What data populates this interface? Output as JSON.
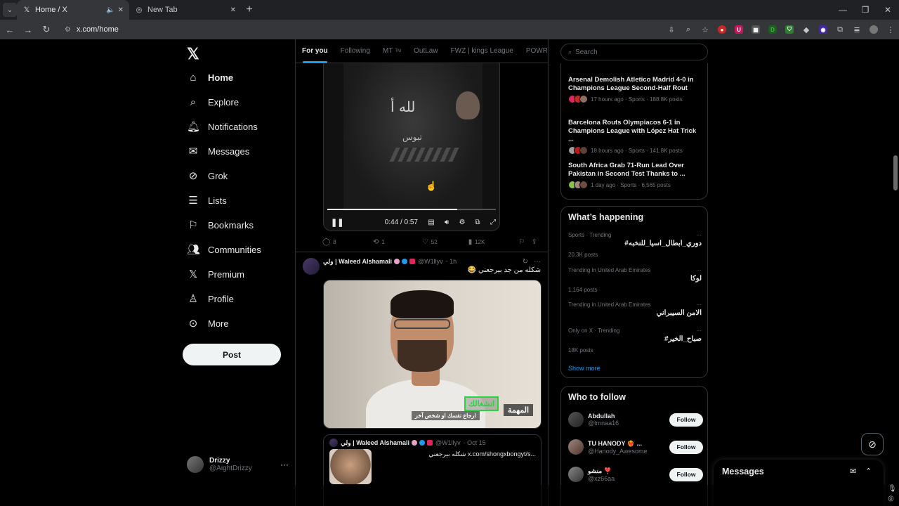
{
  "browser": {
    "tabs": [
      {
        "title": "Home / X",
        "favicon": "x-logo-icon",
        "active": true
      },
      {
        "title": "New Tab",
        "favicon": "chrome-icon",
        "active": false
      }
    ],
    "url": "x.com/home"
  },
  "nav": {
    "items": [
      {
        "label": "Home",
        "icon": "home-icon"
      },
      {
        "label": "Explore",
        "icon": "search-icon"
      },
      {
        "label": "Notifications",
        "icon": "bell-icon"
      },
      {
        "label": "Messages",
        "icon": "mail-icon"
      },
      {
        "label": "Grok",
        "icon": "grok-icon"
      },
      {
        "label": "Lists",
        "icon": "list-icon"
      },
      {
        "label": "Bookmarks",
        "icon": "bookmark-icon"
      },
      {
        "label": "Communities",
        "icon": "communities-icon"
      },
      {
        "label": "Premium",
        "icon": "x-premium-icon"
      },
      {
        "label": "Profile",
        "icon": "person-icon"
      },
      {
        "label": "More",
        "icon": "more-circle-icon"
      }
    ],
    "post_label": "Post",
    "account": {
      "name": "Drizzy",
      "handle": "@AightDrizzy"
    }
  },
  "feed": {
    "tabs": [
      {
        "label": "For you",
        "active": true
      },
      {
        "label": "Following",
        "active": false
      },
      {
        "label": "MT",
        "suffix": "TM",
        "active": false
      },
      {
        "label": "OutLaw",
        "active": false
      },
      {
        "label": "FWZ | kings League",
        "active": false
      },
      {
        "label": "POWR | جو",
        "active": false
      }
    ],
    "video": {
      "overlay_text_1": "لله أ",
      "overlay_text_2": "تبوس",
      "time": "0:44 / 0:57",
      "progress": 0.77
    },
    "post1_actions": {
      "replies": "8",
      "reposts": "1",
      "likes": "52",
      "views": "12K"
    },
    "post2": {
      "name": "ولي | Waleed Alshamali",
      "handle": "@W1llyv",
      "time": "· 1h",
      "text": "شكله من جد بيرجعني 😂",
      "captions": {
        "green": "انشغالك",
        "task": "المهمة",
        "subtitle": "ارجاع نفسك او شخص آخر"
      }
    },
    "quote": {
      "name": "ولي | Waleed Alshamali",
      "handle": "@W1llyv",
      "time": "· Oct 15",
      "text": "شكله بيرجعني x.com/shongxbongyt/s..."
    }
  },
  "right": {
    "search_placeholder": "Search",
    "news": [
      {
        "headline": "Arsenal Demolish Atletico Madrid 4-0 in Champions League Second-Half Rout",
        "meta": "17 hours ago · Sports · 188.8K posts"
      },
      {
        "headline": "Barcelona Routs Olympiacos 6-1 in Champions League with López Hat Trick ...",
        "meta": "18 hours ago · Sports · 141.8K posts"
      },
      {
        "headline": "South Africa Grab 71-Run Lead Over Pakistan in Second Test Thanks to ...",
        "meta": "1 day ago · Sports · 6,565 posts"
      }
    ],
    "happening_title": "What’s happening",
    "trends": [
      {
        "context": "Sports · Trending",
        "name": "#دوري_ابطال_اسيا_للنخبه",
        "count": "20.3K posts"
      },
      {
        "context": "Trending in United Arab Emirates",
        "name": "لوكا",
        "count": "1,164 posts"
      },
      {
        "context": "Trending in United Arab Emirates",
        "name": "الامن السيبراني",
        "count": ""
      },
      {
        "context": "Only on X · Trending",
        "name": "#صباح_الخير",
        "count": "18K posts"
      }
    ],
    "show_more": "Show more",
    "wtf_title": "Who to follow",
    "follow": [
      {
        "name": "Abdullah",
        "handle": "@tmnaa16",
        "button": "Follow"
      },
      {
        "name": "TU HANODY ❤️‍🔥 ...",
        "handle": "@Hanody_Awesome",
        "button": "Follow"
      },
      {
        "name": "منشو ❣️",
        "handle": "@xz66aa",
        "button": "Follow"
      }
    ],
    "messages_title": "Messages"
  },
  "colors": {
    "accent": "#1d9bf0",
    "bg": "#000000",
    "border": "#2f3336",
    "muted": "#71767b"
  }
}
